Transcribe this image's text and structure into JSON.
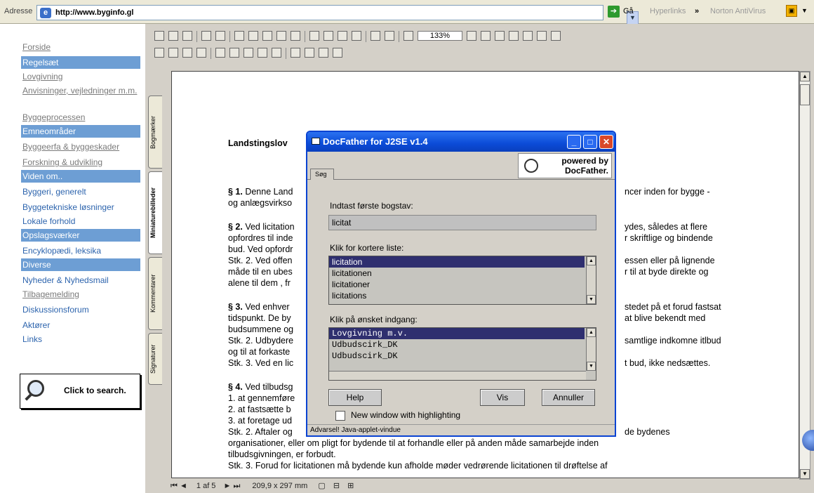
{
  "address": {
    "label": "Adresse",
    "url": "http://www.byginfo.gl",
    "go": "Gå",
    "hyperlinks": "Hyperlinks",
    "chevron": "»",
    "norton": "Norton AntiVirus"
  },
  "nav": {
    "items": [
      {
        "label": "Forside",
        "style": "ul-blue"
      },
      {
        "label": "Regelsæt",
        "style": "head"
      },
      {
        "label": "Lovgivning",
        "style": "ul"
      },
      {
        "label": "Anvisninger, vejledninger m.m.",
        "style": "ul"
      },
      {
        "label": "Byggeprocessen",
        "style": "ul"
      },
      {
        "label": "Emneområder",
        "style": "head"
      },
      {
        "label": "Byggeerfa & byggeskader",
        "style": "ul"
      },
      {
        "label": "Forskning & udvikling",
        "style": "ul"
      },
      {
        "label": "Viden om..",
        "style": "head"
      },
      {
        "label": "Byggeri, generelt",
        "style": "plain"
      },
      {
        "label": "Byggetekniske løsninger",
        "style": "plain"
      },
      {
        "label": "Lokale forhold",
        "style": "plain"
      },
      {
        "label": "Opslagsværker",
        "style": "head"
      },
      {
        "label": "Encyklopædi, leksika",
        "style": "plain"
      },
      {
        "label": "Diverse",
        "style": "head"
      },
      {
        "label": "Nyheder & Nyhedsmail",
        "style": "plain"
      },
      {
        "label": "Tilbagemelding",
        "style": "ul"
      },
      {
        "label": "Diskussionsforum",
        "style": "plain"
      },
      {
        "label": "Aktører",
        "style": "plain"
      },
      {
        "label": "Links",
        "style": "plain"
      }
    ],
    "search_button": "Click to search."
  },
  "acrobat": {
    "zoom": "133%",
    "tabs": [
      "Bogmærker",
      "Miniaturebilleder",
      "Kommentarer",
      "Signaturer"
    ],
    "status": {
      "page": "1 af 5",
      "size": "209,9 x 297 mm"
    }
  },
  "document": {
    "title": "Landstingslov",
    "lines": [
      {
        "bold": "§ 1.",
        "text": " Denne Land",
        "right": "ncer inden for bygge -"
      },
      {
        "bold": "",
        "text": "og anlægsvirkso",
        "right": ""
      },
      {
        "bold": "§ 2.",
        "text": " Ved licitation",
        "right": "ydes, således at flere"
      },
      {
        "bold": "",
        "text": "opfordres til inde",
        "right": "r skriftlige og bindende"
      },
      {
        "bold": "",
        "text": "bud. Ved opfordr",
        "right": ""
      },
      {
        "bold": "",
        "text": "Stk. 2. Ved offen",
        "right": "essen eller på lignende"
      },
      {
        "bold": "",
        "text": "måde til en ubes",
        "right": "r til at byde direkte og"
      },
      {
        "bold": "",
        "text": "alene til dem , fr",
        "right": ""
      },
      {
        "bold": "§ 3.",
        "text": " Ved enhver",
        "right": "stedet på et forud fastsat"
      },
      {
        "bold": "",
        "text": "tidspunkt. De by",
        "right": "at blive bekendt med"
      },
      {
        "bold": "",
        "text": "budsummene og",
        "right": ""
      },
      {
        "bold": "",
        "text": "Stk. 2. Udbydere",
        "right": "samtlige indkomne itlbud"
      },
      {
        "bold": "",
        "text": "og til at forkaste",
        "right": ""
      },
      {
        "bold": "",
        "text": "Stk. 3. Ved en lic",
        "right": "t bud, ikke nedsættes."
      },
      {
        "bold": "§ 4.",
        "text": " Ved tilbudsg",
        "right": ""
      },
      {
        "bold": "",
        "text": "1. at gennemføre",
        "right": ""
      },
      {
        "bold": "",
        "text": "2. at fastsætte b",
        "right": ""
      },
      {
        "bold": "",
        "text": "3. at foretage ud",
        "right": ""
      }
    ],
    "tail": [
      "Stk. 2. Aftaler og",
      "organisationer, eller om pligt for bydende til at forhandle eller på anden måde samarbejde inden",
      "tilbudsgivningen, er forbudt.",
      "Stk. 3. Forud for licitationen må bydende kun afholde møder vedrørende licitationen til drøftelse af"
    ],
    "tail_right": "de bydenes"
  },
  "dialog": {
    "title": "DocFather for J2SE v1.4",
    "tab": "Søg",
    "logo_top": "powered by",
    "logo_bottom": "DocFather.",
    "label1": "Indtast første bogstav:",
    "input": "licitat",
    "label2": "Klik for kortere liste:",
    "list1": [
      "licitation",
      "licitationen",
      "licitationer",
      "licitations"
    ],
    "label3": "Klik på ønsket indgang:",
    "list2": [
      "Lovgivning m.v.",
      "Udbudscirk_DK",
      "Udbudscirk_DK"
    ],
    "help": "Help",
    "vis": "Vis",
    "annuller": "Annuller",
    "checkbox": "New window with highlighting",
    "warning": "Advarsel! Java-applet-vindue"
  }
}
